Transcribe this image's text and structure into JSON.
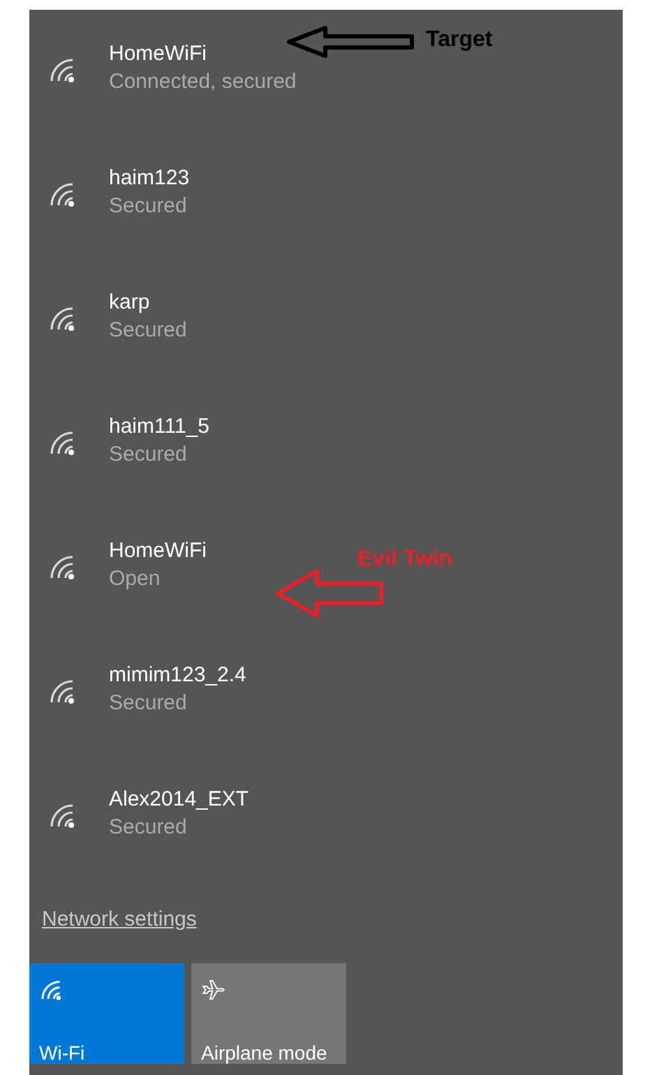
{
  "networks": [
    {
      "name": "HomeWiFi",
      "status": "Connected, secured",
      "annotation": {
        "kind": "name",
        "text": "Target",
        "color": "#000000"
      }
    },
    {
      "name": "haim123",
      "status": "Secured"
    },
    {
      "name": "karp",
      "status": "Secured"
    },
    {
      "name": "haim111_5",
      "status": "Secured"
    },
    {
      "name": "HomeWiFi",
      "status": "Open",
      "annotation": {
        "kind": "status",
        "text": "Evil Twin",
        "color": "#e8202a"
      }
    },
    {
      "name": "mimim123_2.4",
      "status": "Secured"
    },
    {
      "name": "Alex2014_EXT",
      "status": "Secured"
    }
  ],
  "settings_link": "Network settings",
  "tiles": [
    {
      "kind": "wifi",
      "label": "Wi-Fi",
      "selected": true
    },
    {
      "kind": "airplane",
      "label": "Airplane mode",
      "selected": false
    }
  ]
}
